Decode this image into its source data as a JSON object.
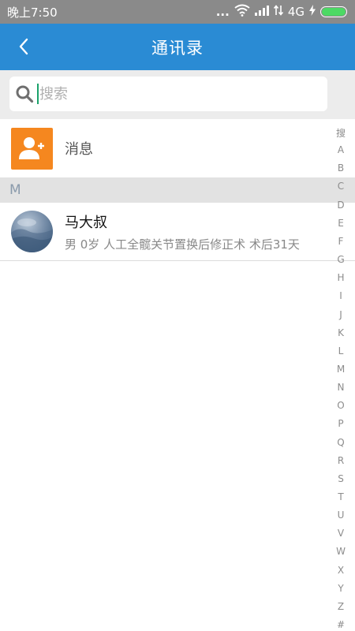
{
  "status_bar": {
    "time": "晚上7:50",
    "dots": "...",
    "network": "4G"
  },
  "app_bar": {
    "title": "通讯录"
  },
  "search": {
    "placeholder": "搜索",
    "value": ""
  },
  "message_row": {
    "label": "消息"
  },
  "section": {
    "header": "M"
  },
  "contacts": [
    {
      "name": "马大叔",
      "detail": "男 0岁 人工全髋关节置换后修正术 术后31天"
    }
  ],
  "index_bar": [
    "搜",
    "A",
    "B",
    "C",
    "D",
    "E",
    "F",
    "G",
    "H",
    "I",
    "J",
    "K",
    "L",
    "M",
    "N",
    "O",
    "P",
    "Q",
    "R",
    "S",
    "T",
    "U",
    "V",
    "W",
    "X",
    "Y",
    "Z",
    "#"
  ],
  "colors": {
    "status_bar": "#8a8a8a",
    "app_bar": "#2a8bd4",
    "accent_orange": "#f5871f",
    "section_bg": "#e2e2e2",
    "battery": "#4cd964"
  }
}
